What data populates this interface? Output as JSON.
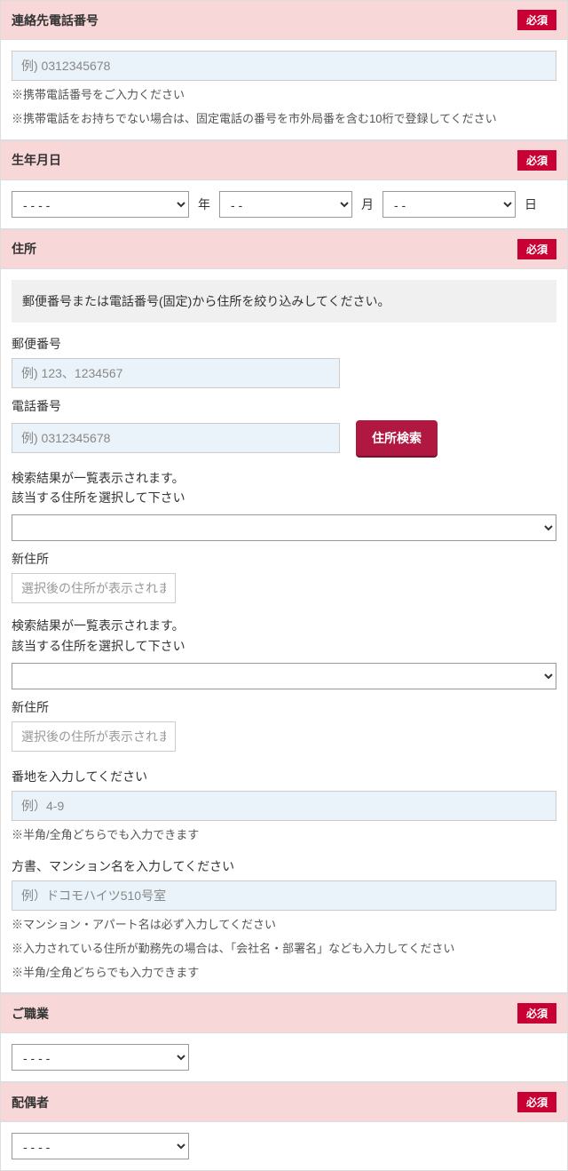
{
  "required_badge": "必須",
  "phone": {
    "title": "連絡先電話番号",
    "placeholder": "例) 0312345678",
    "note1": "※携帯電話番号をご入力ください",
    "note2": "※携帯電話をお持ちでない場合は、固定電話の番号を市外局番を含む10桁で登録してください"
  },
  "birth": {
    "title": "生年月日",
    "year_default": "- - - -",
    "year_unit": "年",
    "month_default": "- -",
    "month_unit": "月",
    "day_default": "- -",
    "day_unit": "日"
  },
  "address": {
    "title": "住所",
    "info": "郵便番号または電話番号(固定)から住所を絞り込みしてください。",
    "zip_label": "郵便番号",
    "zip_placeholder": "例) 123、1234567",
    "tel_label": "電話番号",
    "tel_placeholder": "例) 0312345678",
    "search_btn": "住所検索",
    "result_line1": "検索結果が一覧表示されます。",
    "result_line2": "該当する住所を選択して下さい",
    "new_addr_label": "新住所",
    "new_addr_placeholder": "選択後の住所が表示されます",
    "banchi_label": "番地を入力してください",
    "banchi_placeholder": "例）4-9",
    "banchi_note": "※半角/全角どちらでも入力できます",
    "building_label": "方書、マンション名を入力してください",
    "building_placeholder": "例）ドコモハイツ510号室",
    "building_note1": "※マンション・アパート名は必ず入力してください",
    "building_note2": "※入力されている住所が勤務先の場合は、「会社名・部署名」なども入力してください",
    "building_note3": "※半角/全角どちらでも入力できます"
  },
  "occupation": {
    "title": "ご職業",
    "default": "- - - -"
  },
  "spouse": {
    "title": "配偶者",
    "default": "- - - -"
  }
}
